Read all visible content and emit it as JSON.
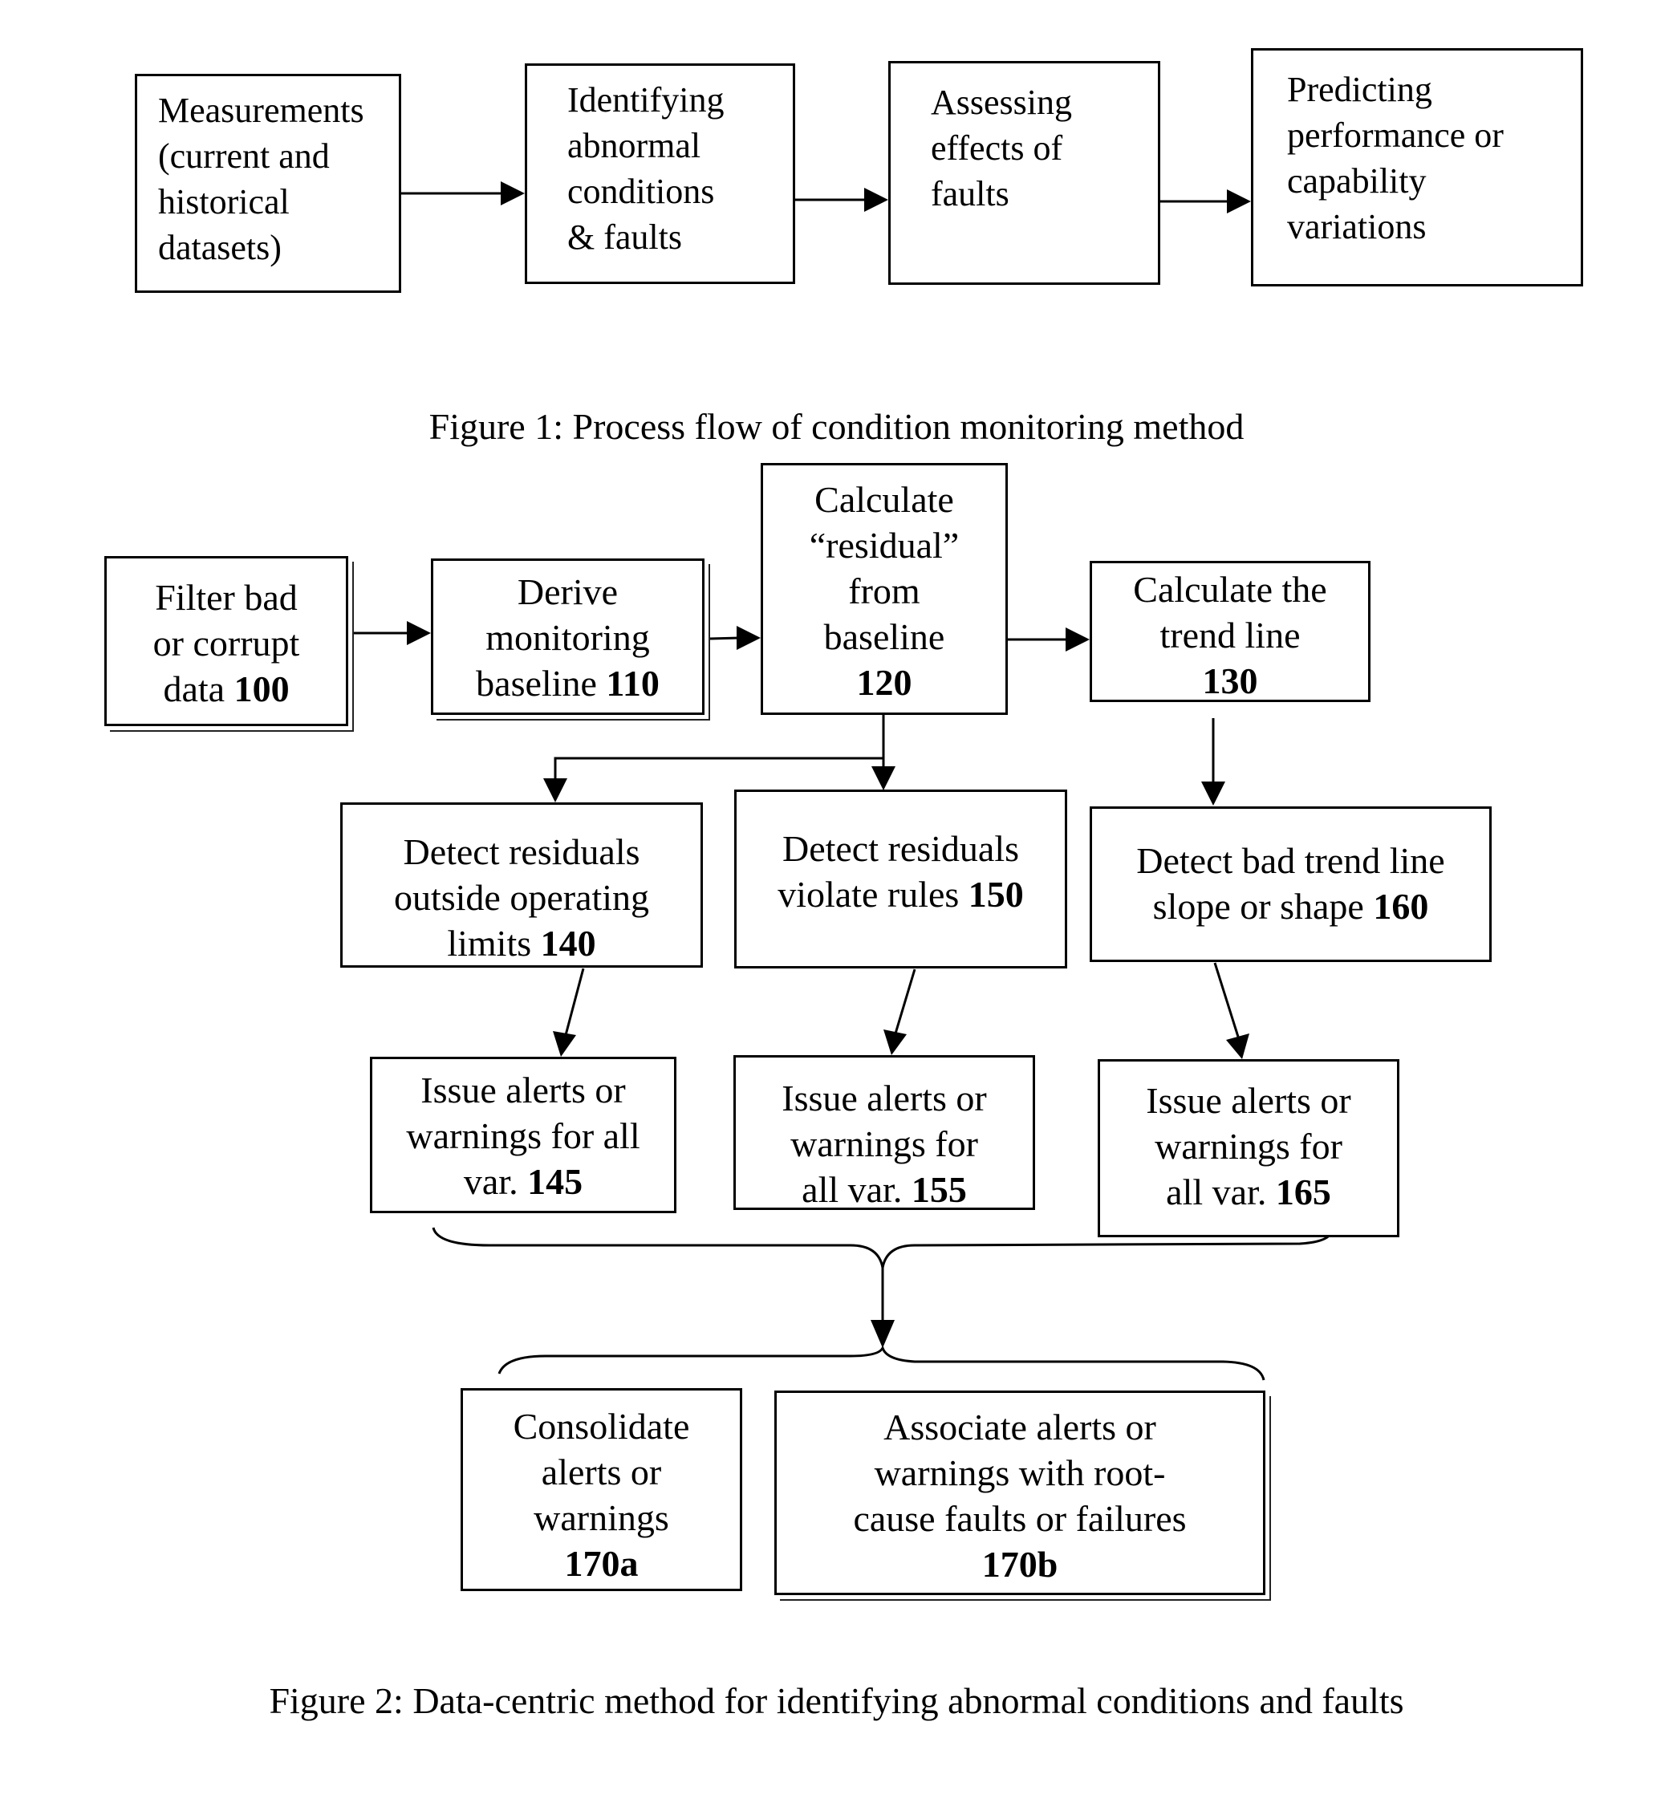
{
  "figure1": {
    "caption": "Figure 1: Process flow of condition monitoring method",
    "steps": [
      {
        "text": "Measurements\n(current and\nhistorical\ndatasets)"
      },
      {
        "text": "Identifying\nabnormal\nconditions\n& faults"
      },
      {
        "text": "Assessing\neffects of\nfaults"
      },
      {
        "text": "Predicting\nperformance or\ncapability\nvariations"
      }
    ]
  },
  "figure2": {
    "caption": "Figure 2: Data-centric method for identifying abnormal conditions and faults",
    "nodes": {
      "n100": {
        "text": "Filter bad\nor corrupt\ndata ",
        "ref": "100"
      },
      "n110": {
        "text": "Derive\nmonitoring\nbaseline ",
        "ref": "110"
      },
      "n120": {
        "text": "Calculate\n“residual”\nfrom\nbaseline\n",
        "ref": "120"
      },
      "n130": {
        "text": "Calculate the\ntrend line\n",
        "ref": "130"
      },
      "n140": {
        "text": "Detect residuals\noutside operating\nlimits ",
        "ref": "140"
      },
      "n150": {
        "text": "Detect residuals\nviolate rules ",
        "ref": "150"
      },
      "n160": {
        "text": "Detect bad trend line\nslope or shape ",
        "ref": "160"
      },
      "n145": {
        "text": "Issue alerts or\nwarnings for all\nvar. ",
        "ref": "145"
      },
      "n155": {
        "text": "Issue alerts or\nwarnings for\nall var. ",
        "ref": "155"
      },
      "n165": {
        "text": "Issue alerts or\nwarnings for\nall var. ",
        "ref": "165"
      },
      "n170a": {
        "text": "Consolidate\nalerts or\nwarnings\n",
        "ref": "170a"
      },
      "n170b": {
        "text": "Associate alerts or\nwarnings with root-\ncause faults or failures\n",
        "ref": "170b"
      }
    }
  }
}
